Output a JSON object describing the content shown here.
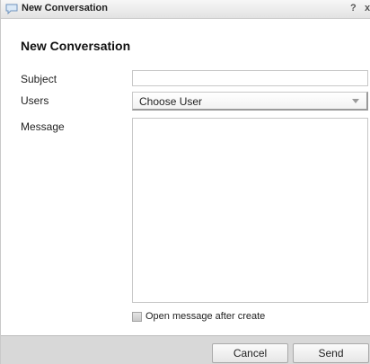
{
  "window": {
    "title": "New Conversation",
    "help_label": "?",
    "close_label": "x"
  },
  "form": {
    "heading": "New Conversation",
    "subject_label": "Subject",
    "subject_value": "",
    "users_label": "Users",
    "users_selected": "Choose User",
    "message_label": "Message",
    "message_value": "",
    "open_after_create_label": "Open message after create",
    "open_after_create_checked": false
  },
  "footer": {
    "cancel_label": "Cancel",
    "send_label": "Send"
  },
  "icons": {
    "title_icon": "speech-bubble-icon",
    "select_icon": "chevron-down-icon"
  },
  "colors": {
    "titlebar_bg": "#e2e2e2",
    "footer_bg": "#d8d8d8",
    "border": "#c7c7c7"
  }
}
